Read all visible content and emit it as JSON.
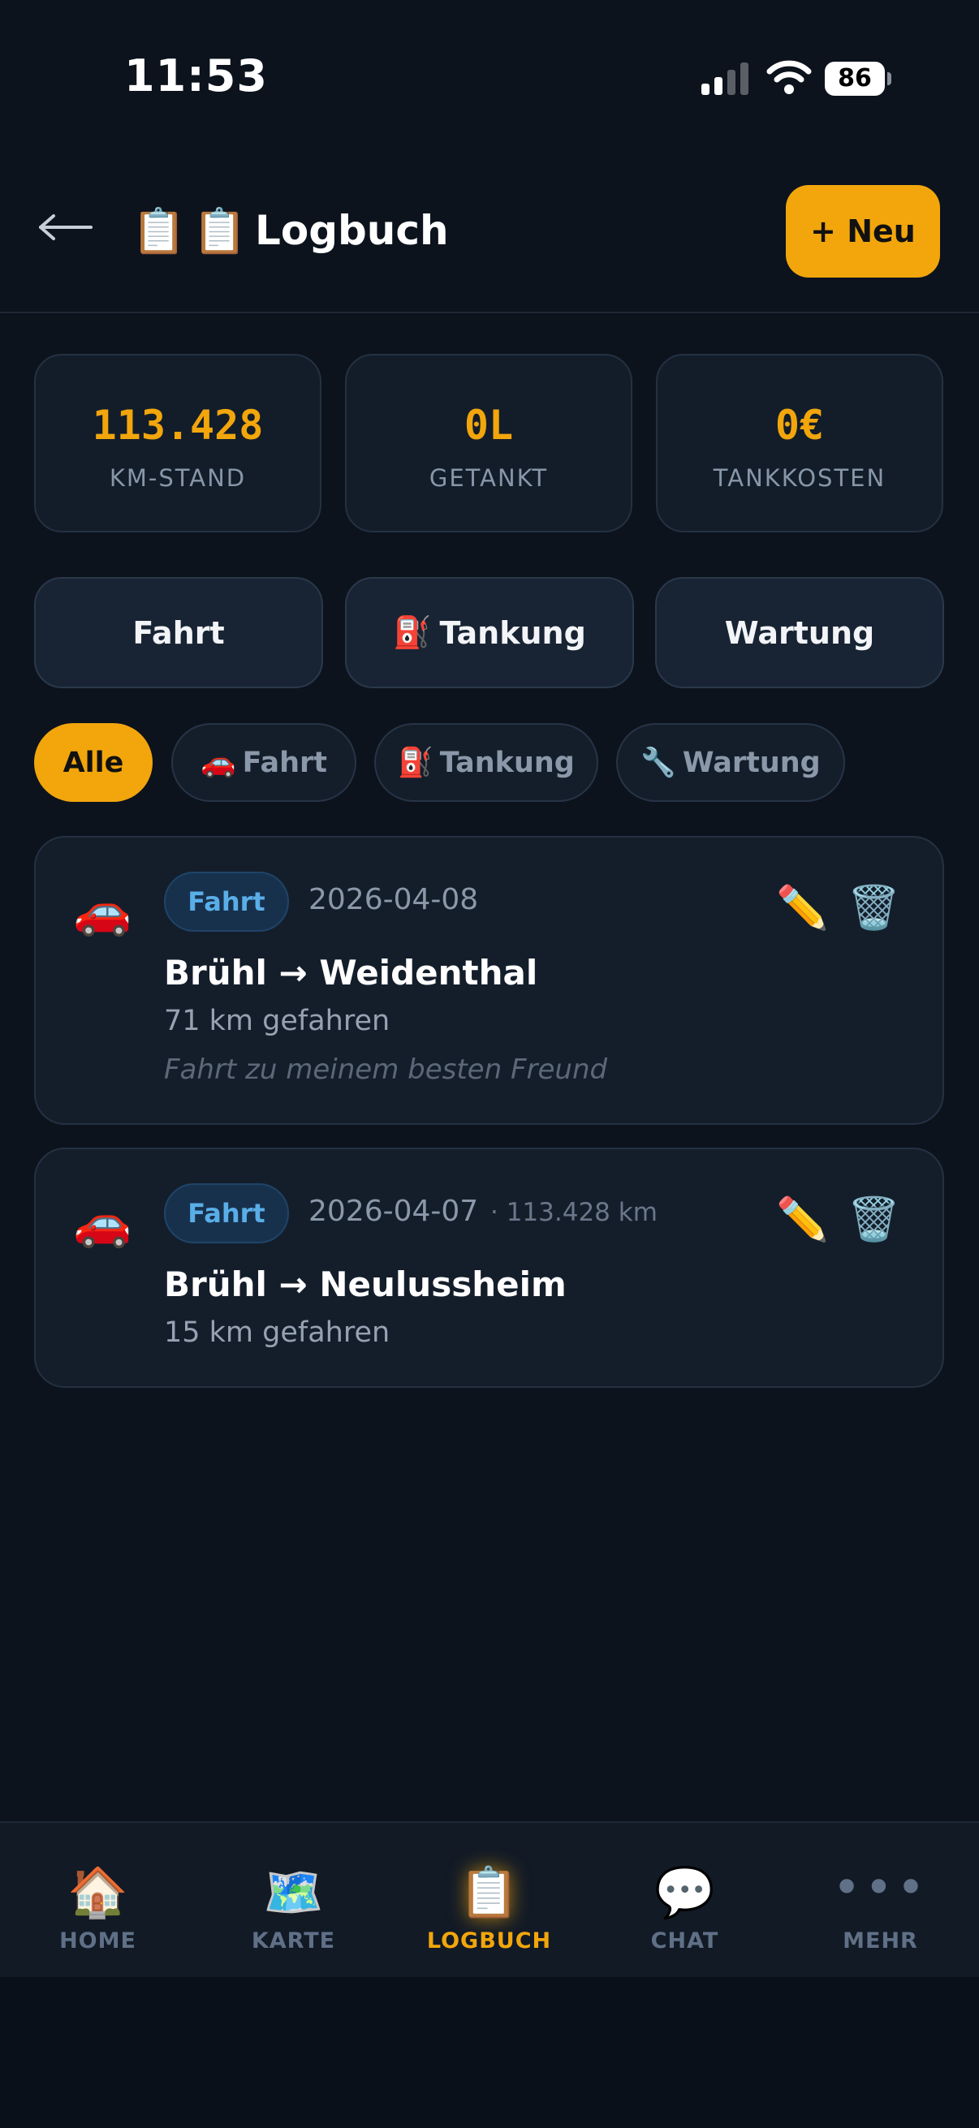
{
  "status_bar": {
    "time": "11:53",
    "battery": "86",
    "icons": [
      "signal-icon",
      "wifi-icon",
      "battery-icon"
    ]
  },
  "header": {
    "title_icons": "📋📋",
    "title": "Logbuch",
    "new_button_label": "+ Neu"
  },
  "stats": [
    {
      "value": "113.428",
      "label": "KM-STAND"
    },
    {
      "value": "0L",
      "label": "GETANKT"
    },
    {
      "value": "0€",
      "label": "TANKKOSTEN"
    }
  ],
  "quick_actions": [
    {
      "emoji": "",
      "label": "Fahrt"
    },
    {
      "emoji": "⛽",
      "label": "Tankung"
    },
    {
      "emoji": "",
      "label": "Wartung"
    }
  ],
  "filters": [
    {
      "emoji": "",
      "label": "Alle",
      "active": true
    },
    {
      "emoji": "🚗",
      "label": "Fahrt",
      "active": false
    },
    {
      "emoji": "⛽",
      "label": "Tankung",
      "active": false
    },
    {
      "emoji": "🔧",
      "label": "Wartung",
      "active": false
    }
  ],
  "entries": [
    {
      "emoji": "🚗",
      "type": "Fahrt",
      "date": "2026-04-08",
      "km": "",
      "route": "Brühl → Weidenthal",
      "distance": "71 km gefahren",
      "note": "Fahrt zu meinem besten Freund",
      "edit_icon": "✏️",
      "delete_icon": "🗑️"
    },
    {
      "emoji": "🚗",
      "type": "Fahrt",
      "date": "2026-04-07",
      "km": "· 113.428 km",
      "route": "Brühl → Neulussheim",
      "distance": "15 km gefahren",
      "note": "",
      "edit_icon": "✏️",
      "delete_icon": "🗑️"
    }
  ],
  "nav": [
    {
      "icon": "🏠",
      "label": "HOME",
      "active": false
    },
    {
      "icon": "🗺️",
      "label": "KARTE",
      "active": false
    },
    {
      "icon": "📋",
      "label": "LOGBUCH",
      "active": true
    },
    {
      "icon": "💬",
      "label": "CHAT",
      "active": false
    },
    {
      "icon": "•••",
      "label": "MEHR",
      "active": false
    }
  ],
  "colors": {
    "accent": "#f2a60c",
    "background": "#0c131d",
    "card": "#141e2b",
    "badge_text": "#5aaee8"
  }
}
